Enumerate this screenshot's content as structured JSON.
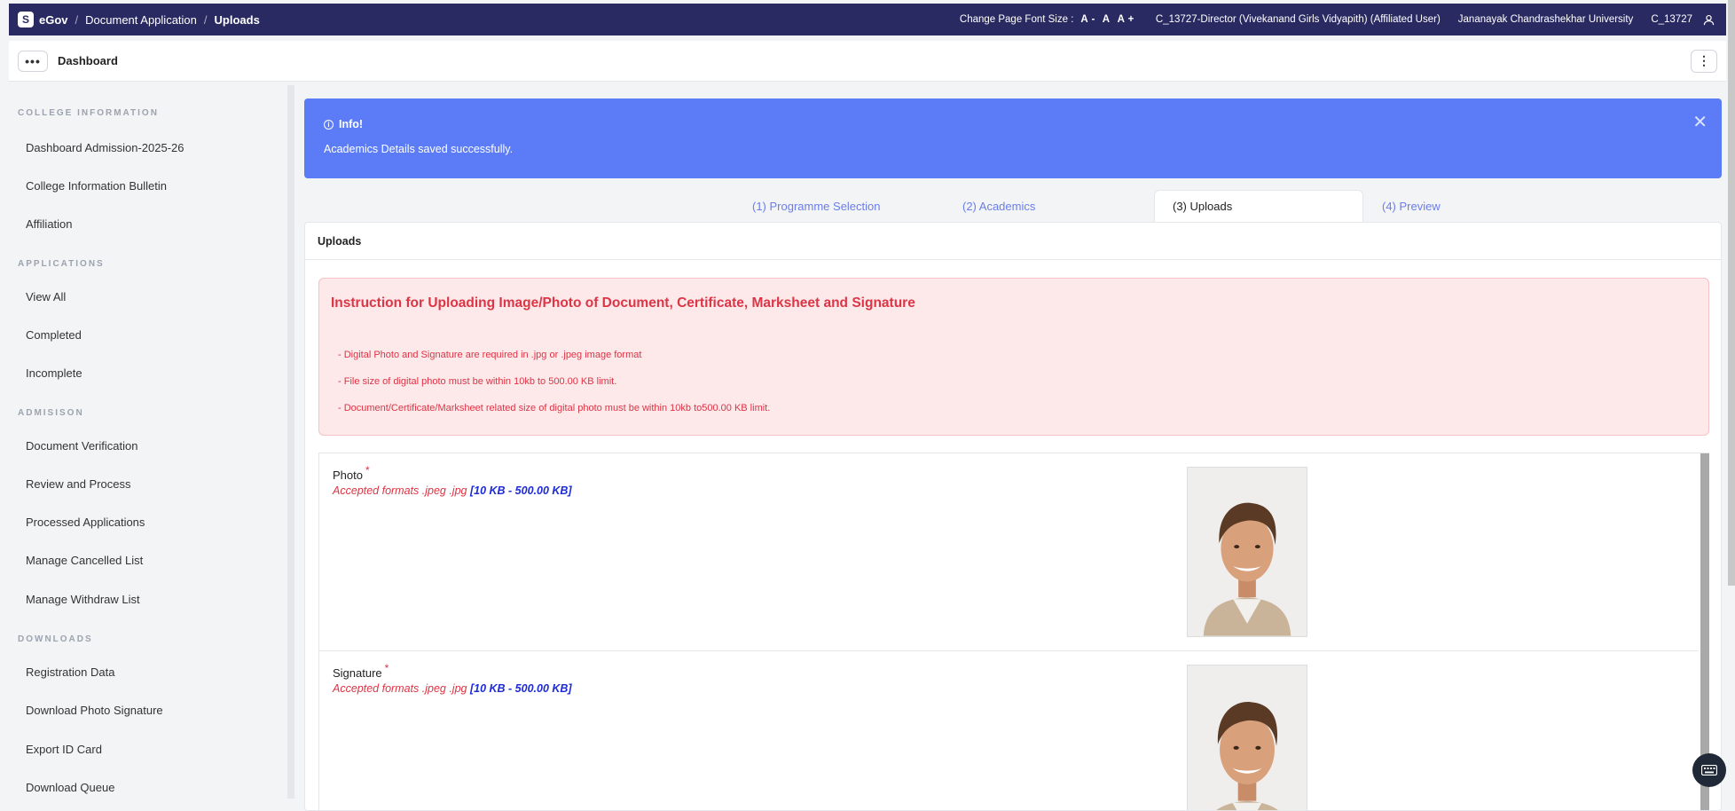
{
  "topbar": {
    "logo_letter": "S",
    "app_name": "eGov",
    "breadcrumb": [
      "Document Application",
      "Uploads"
    ],
    "font_size_label": "Change Page Font Size :",
    "font_size_controls": [
      "A -",
      "A",
      "A +"
    ],
    "user_role": "C_13727-Director (Vivekanand Girls Vidyapith) (Affiliated User)",
    "university": "Jananayak Chandrashekhar University",
    "user_id": "C_13727"
  },
  "subbar": {
    "menu_icon": "ellipsis-icon",
    "title": "Dashboard",
    "more_icon": "vertical-dots-icon"
  },
  "sidebar": {
    "sections": [
      {
        "title": "COLLEGE INFORMATION",
        "items": [
          "Dashboard Admission-2025-26",
          "College Information Bulletin",
          "Affiliation"
        ]
      },
      {
        "title": "APPLICATIONS",
        "items": [
          "View All",
          "Completed",
          "Incomplete"
        ]
      },
      {
        "title": "ADMISISON",
        "items": [
          "Document Verification",
          "Review and Process",
          "Processed Applications",
          "Manage Cancelled List",
          "Manage Withdraw List"
        ]
      },
      {
        "title": "DOWNLOADS",
        "items": [
          "Registration Data",
          "Download Photo Signature",
          "Export ID Card",
          "Download Queue"
        ]
      }
    ]
  },
  "alert": {
    "title": "Info!",
    "message": "Academics Details saved successfully.",
    "color": "#5b7cf6"
  },
  "tabs": [
    {
      "label": "(1) Programme Selection",
      "active": false
    },
    {
      "label": "(2) Academics",
      "active": false
    },
    {
      "label": "(3) Uploads",
      "active": true
    },
    {
      "label": "(4) Preview",
      "active": false
    }
  ],
  "card": {
    "title": "Uploads",
    "instructions": {
      "title": "Instruction for Uploading Image/Photo of Document, Certificate, Marksheet and Signature",
      "items": [
        "- Digital Photo and Signature are required in .jpg or .jpeg image format",
        "- File size of digital photo must be within 10kb to 500.00 KB limit.",
        "- Document/Certificate/Marksheet related size of digital photo must be within 10kb to500.00 KB limit."
      ]
    },
    "uploads": [
      {
        "label": "Photo",
        "required_mark": "*",
        "formats": "Accepted formats .jpeg .jpg",
        "size": "[10 KB - 500.00 KB]"
      },
      {
        "label": "Signature",
        "required_mark": "*",
        "formats": "Accepted formats .jpeg .jpg",
        "size": "[10 KB - 500.00 KB]"
      }
    ]
  },
  "floating": {
    "keyboard_icon": "keyboard-icon"
  }
}
